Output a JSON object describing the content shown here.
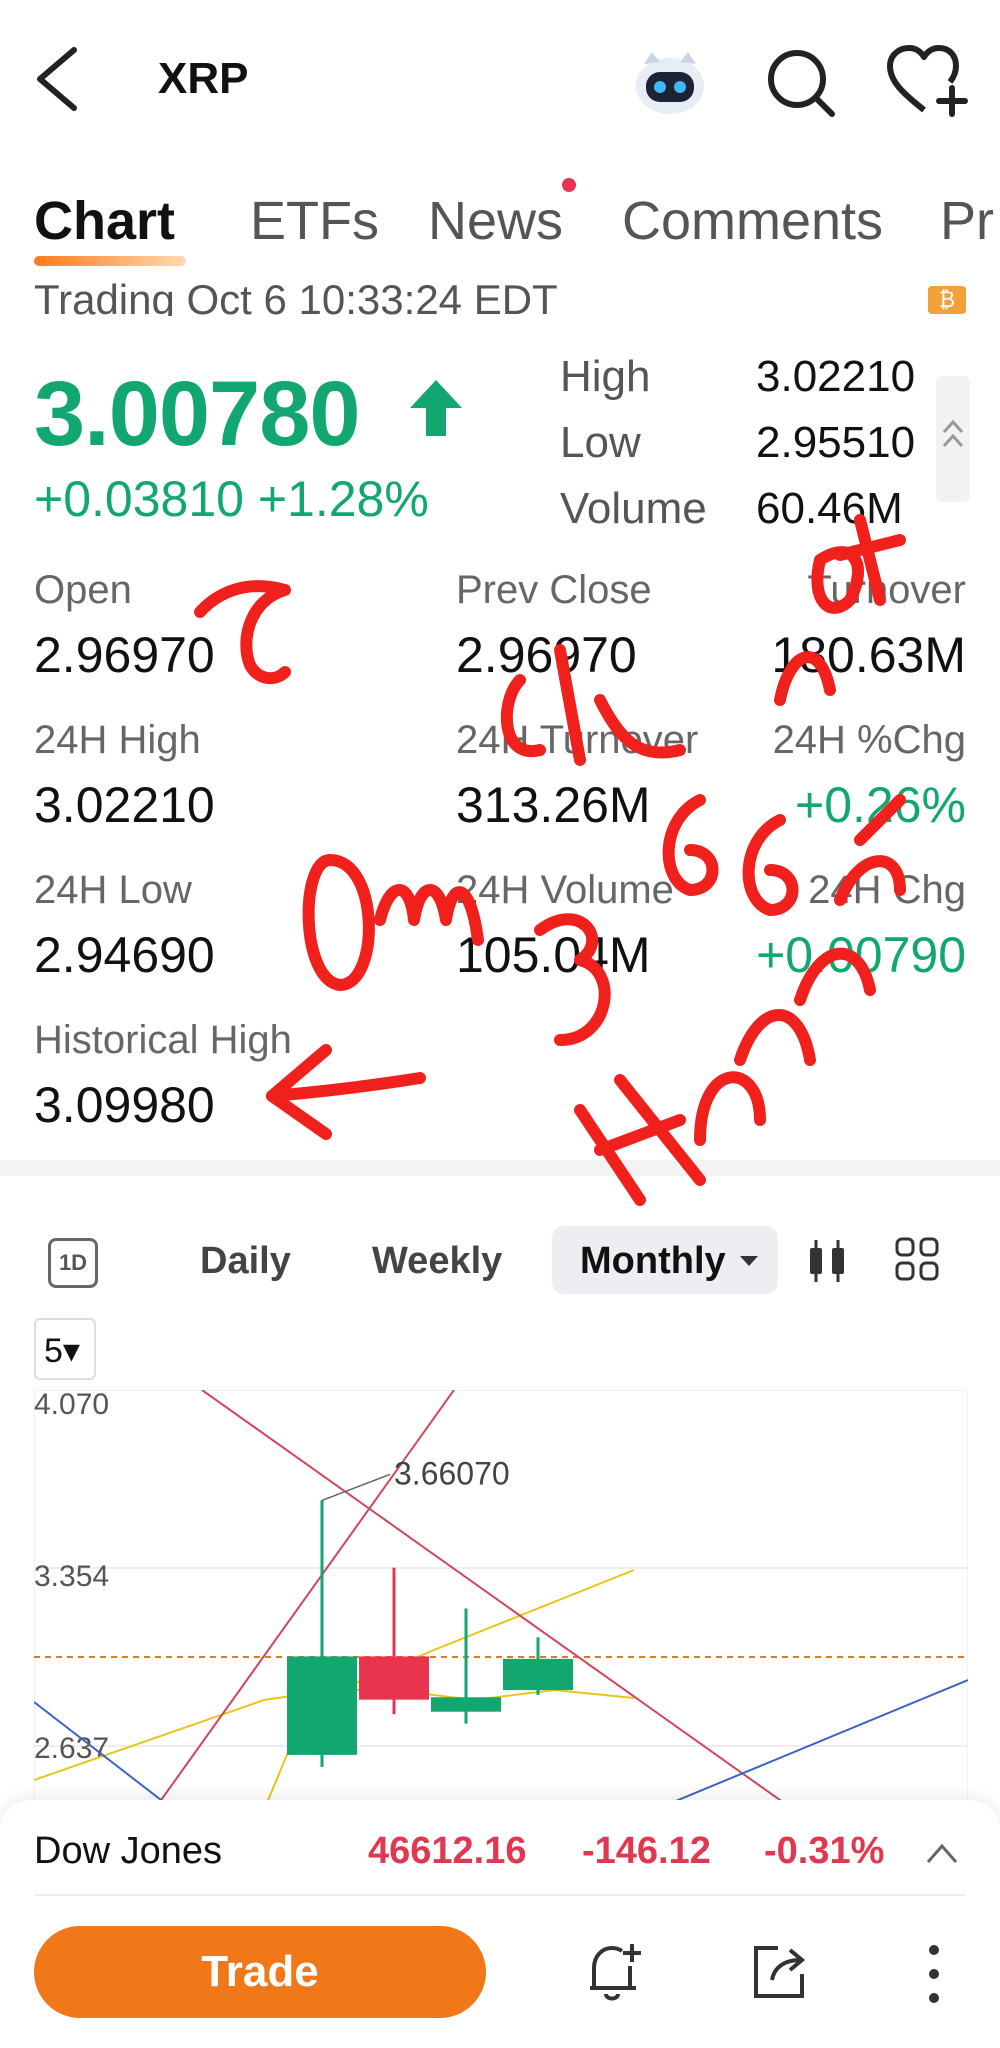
{
  "header": {
    "title": "XRP"
  },
  "tabs": [
    {
      "label": "Chart",
      "active": true
    },
    {
      "label": "ETFs"
    },
    {
      "label": "News"
    },
    {
      "label": "Comments"
    },
    {
      "label": "Pr"
    }
  ],
  "status": {
    "text": "Trading  Oct 6 10:33:24 EDT",
    "badge": "₿"
  },
  "quote": {
    "price": "3.00780",
    "change": "+0.03810 +1.28%",
    "high_label": "High",
    "high": "3.02210",
    "low_label": "Low",
    "low": "2.95510",
    "volume_label": "Volume",
    "volume": "60.46M"
  },
  "stats": {
    "open_label": "Open",
    "open": "2.96970",
    "prev_close_label": "Prev Close",
    "prev_close": "2.96970",
    "turnover_label": "Turnover",
    "turnover": "180.63M",
    "h24_high_label": "24H High",
    "h24_high": "3.02210",
    "h24_turnover_label": "24H Turnover",
    "h24_turnover": "313.26M",
    "h24_pct_label": "24H %Chg",
    "h24_pct": "+0.26%",
    "h24_low_label": "24H Low",
    "h24_low": "2.94690",
    "h24_volume_label": "24H Volume",
    "h24_volume": "105.04M",
    "h24_chg_label": "24H Chg",
    "h24_chg": "+0.00790",
    "hist_high_label": "Historical High",
    "hist_high": "3.09980"
  },
  "chart_toolbar": {
    "one_d": "1D",
    "daily": "Daily",
    "weekly": "Weekly",
    "monthly": "Monthly",
    "count": "5▾"
  },
  "chart_data": {
    "type": "candlestick",
    "y_tick_labels": [
      "4.070",
      "3.354",
      "2.637"
    ],
    "annotation": "3.66070",
    "reference_line": 3.0078,
    "candles": [
      {
        "open": 2.6,
        "close": 3.01,
        "high": 3.66,
        "low": 2.55,
        "color": "#12a671"
      },
      {
        "open": 3.01,
        "close": 2.83,
        "high": 3.38,
        "low": 2.77,
        "color": "#e8344e"
      },
      {
        "open": 2.78,
        "close": 2.84,
        "high": 3.21,
        "low": 2.73,
        "color": "#12a671"
      },
      {
        "open": 2.87,
        "close": 3.0,
        "high": 3.09,
        "low": 2.85,
        "color": "#12a671"
      }
    ]
  },
  "ticker": {
    "name": "Dow Jones",
    "value": "46612.16",
    "change": "-146.12",
    "pct": "-0.31%"
  },
  "actions": {
    "trade": "Trade"
  },
  "handwriting": {
    "text": "Om did 3.66 not Happen"
  }
}
